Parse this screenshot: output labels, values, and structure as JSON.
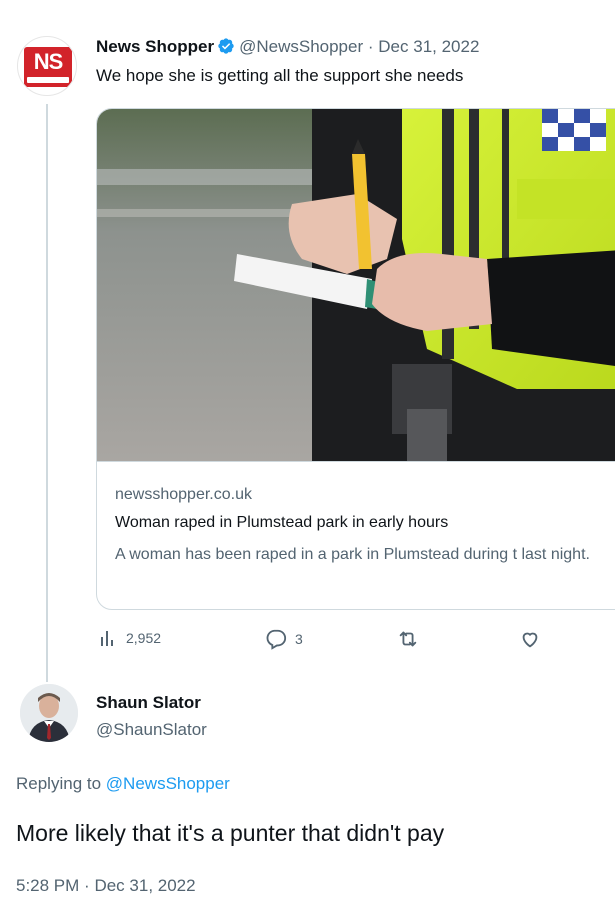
{
  "tweet": {
    "author_name": "News Shopper",
    "handle": "@NewsShopper",
    "separator": "·",
    "date": "Dec 31, 2022",
    "text": "We hope she is getting all the support she needs",
    "avatar_label": "NS",
    "card": {
      "domain": "newsshopper.co.uk",
      "title": "Woman raped in Plumstead park in early hours",
      "description": "A woman has been raped in a park in Plumstead during t last night."
    },
    "actions": {
      "views": "2,952",
      "replies": "3"
    }
  },
  "reply": {
    "author_name": "Shaun Slator",
    "handle": "@ShaunSlator",
    "replying_prefix": "Replying to",
    "replying_to": "@NewsShopper",
    "text": "More likely that it's a punter that didn't pay",
    "time": "5:28 PM",
    "separator": "·",
    "date": "Dec 31, 2022"
  },
  "colors": {
    "accent": "#1d9bf0",
    "text": "#0f1419",
    "muted": "#536471",
    "brand_red": "#d2232a"
  },
  "icons": {
    "verified": "verified-badge-icon",
    "views": "bar-chart-icon",
    "reply": "speech-bubble-icon",
    "retweet": "retweet-icon",
    "like": "heart-icon"
  }
}
